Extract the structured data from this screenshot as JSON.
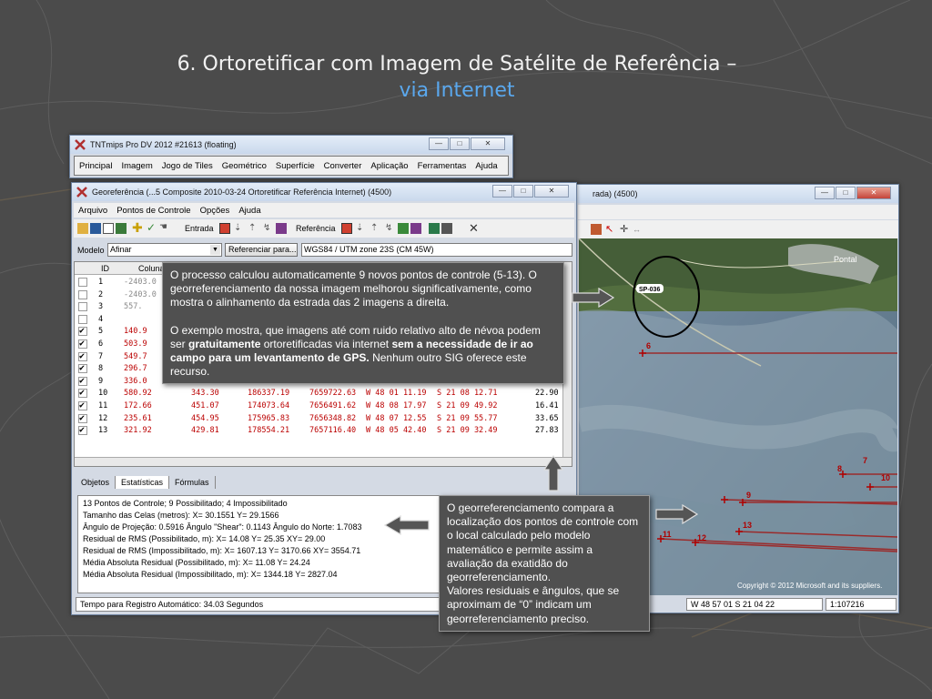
{
  "slide": {
    "title_line1": "6. Ortoretificar com Imagem de Satélite de Referência –",
    "title_line2": "via Internet"
  },
  "main_window": {
    "title": "TNTmips Pro DV 2012  #21613 (floating)",
    "menu": [
      "Principal",
      "Imagem",
      "Jogo de Tiles",
      "Geométrico",
      "Superfície",
      "Converter",
      "Aplicação",
      "Ferramentas",
      "Ajuda"
    ]
  },
  "geo_window": {
    "title": "Georeferência (...5 Composite 2010-03-24 Ortoretificar Referência Internet) (4500)",
    "menu": [
      "Arquivo",
      "Pontos de Controle",
      "Opções",
      "Ajuda"
    ],
    "toolbar": {
      "entrada_label": "Entrada",
      "referencia_label": "Referência"
    },
    "model_label": "Modelo",
    "model_value": "Afinar",
    "ref_button": "Referenciar para...",
    "crs": "WGS84 / UTM zone 23S (CM 45W)",
    "table_headers": {
      "id": "ID",
      "col": "Coluna"
    },
    "rows": [
      {
        "check": false,
        "id": "1",
        "c1": "-2403.0",
        "style": "grey"
      },
      {
        "check": false,
        "id": "2",
        "c1": "-2403.0",
        "style": "grey"
      },
      {
        "check": false,
        "id": "3",
        "c1": "557.",
        "style": "grey"
      },
      {
        "check": false,
        "id": "4",
        "c1": "",
        "style": "grey"
      },
      {
        "check": true,
        "id": "5",
        "c1": "140.9",
        "style": "red"
      },
      {
        "check": true,
        "id": "6",
        "c1": "503.9",
        "style": "red"
      },
      {
        "check": true,
        "id": "7",
        "c1": "549.7",
        "style": "red"
      },
      {
        "check": true,
        "id": "8",
        "c1": "296.7",
        "style": "red"
      },
      {
        "check": true,
        "id": "9",
        "c1": "336.0",
        "style": "red"
      },
      {
        "check": true,
        "id": "10",
        "c1": "580.92",
        "c2": "343.30",
        "c3": "186337.19",
        "c4": "7659722.63",
        "c5": "W 48 01 11.19",
        "c6": "S 21 08 12.71",
        "c7": "22.90",
        "style": "red"
      },
      {
        "check": true,
        "id": "11",
        "c1": "172.66",
        "c2": "451.07",
        "c3": "174073.64",
        "c4": "7656491.62",
        "c5": "W 48 08 17.97",
        "c6": "S 21 09 49.92",
        "c7": "16.41",
        "style": "red"
      },
      {
        "check": true,
        "id": "12",
        "c1": "235.61",
        "c2": "454.95",
        "c3": "175965.83",
        "c4": "7656348.82",
        "c5": "W 48 07 12.55",
        "c6": "S 21 09 55.77",
        "c7": "33.65",
        "style": "red"
      },
      {
        "check": true,
        "id": "13",
        "c1": "321.92",
        "c2": "429.81",
        "c3": "178554.21",
        "c4": "7657116.40",
        "c5": "W 48 05 42.40",
        "c6": "S 21 09 32.49",
        "c7": "27.83",
        "style": "red"
      }
    ],
    "tabs": [
      "Objetos",
      "Estatísticas",
      "Fórmulas"
    ],
    "stats": [
      "13 Pontos de Controle;  9 Possibilitado;  4 Impossibilitado",
      "Tamanho das Celas (metros):  X= 30.1551  Y= 29.1566",
      "Ângulo de Projeção: 0.5916  Ângulo \"Shear\": 0.1143  Ângulo do Norte: 1.7083",
      "Residual de RMS (Possibilitado, m):  X= 14.08  Y= 25.35  XY= 29.00",
      "Residual de RMS (Impossibilitado, m):  X= 1607.13  Y= 3170.66  XY= 3554.71",
      "Média Absoluta Residual (Possibilitado, m):  X= 11.08  Y= 24.24",
      "Média Absoluta Residual (Impossibilitado, m):  X= 1344.18  Y= 2827.04"
    ],
    "status": "Tempo para Registro Automático: 34.03 Segundos"
  },
  "ref_window": {
    "title_fragment": "rada) (4500)",
    "map_labels": {
      "town": "Pontal",
      "road": "SP-036",
      "copyright": "Copyright © 2012 Microsoft and its suppliers."
    },
    "points": [
      "6",
      "7",
      "8",
      "9",
      "10",
      "11",
      "12",
      "13"
    ],
    "status_coords": "W 48 57 01  S 21 04 22",
    "status_scale": "1:107216"
  },
  "callouts": {
    "top_p1": "O processo calculou automaticamente 9 novos pontos de controle (5-13). O georreferenciamento da nossa imagem melhorou significativamente, como mostra o alinhamento da estrada das 2 imagens a direita.",
    "top_p2_a": "O exemplo mostra, que imagens até com ruido relativo alto de névoa podem ser ",
    "top_p2_b": "gratuitamente",
    "top_p2_c": " ortoretificadas via internet ",
    "top_p2_d": "sem a necessidade de ir ao campo para um levantamento de GPS.",
    "top_p2_e": " Nenhum outro SIG oferece este recurso.",
    "bottom_p1": "O georreferenciamento compara a localização dos pontos de controle com o local calculado pelo modelo matemático e permite assim a avaliação da exatidão do georreferenciamento.",
    "bottom_p2": "Valores residuais e ângulos, que se aproximam de “0” indicam um georreferenciamento preciso."
  },
  "colors": {
    "accent": "#5aa8ee",
    "callout_bg": "#505050",
    "point_red": "#b00000"
  }
}
